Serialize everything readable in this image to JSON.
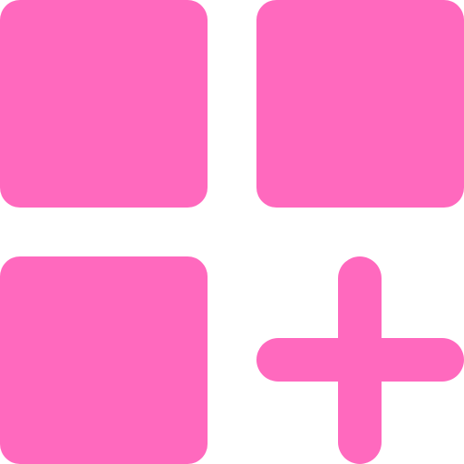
{
  "icon": {
    "name": "add-grid-icon",
    "color": "#ff69be",
    "background": "#ffffff",
    "parts": [
      "grid-tile",
      "grid-tile",
      "grid-tile",
      "plus"
    ]
  }
}
